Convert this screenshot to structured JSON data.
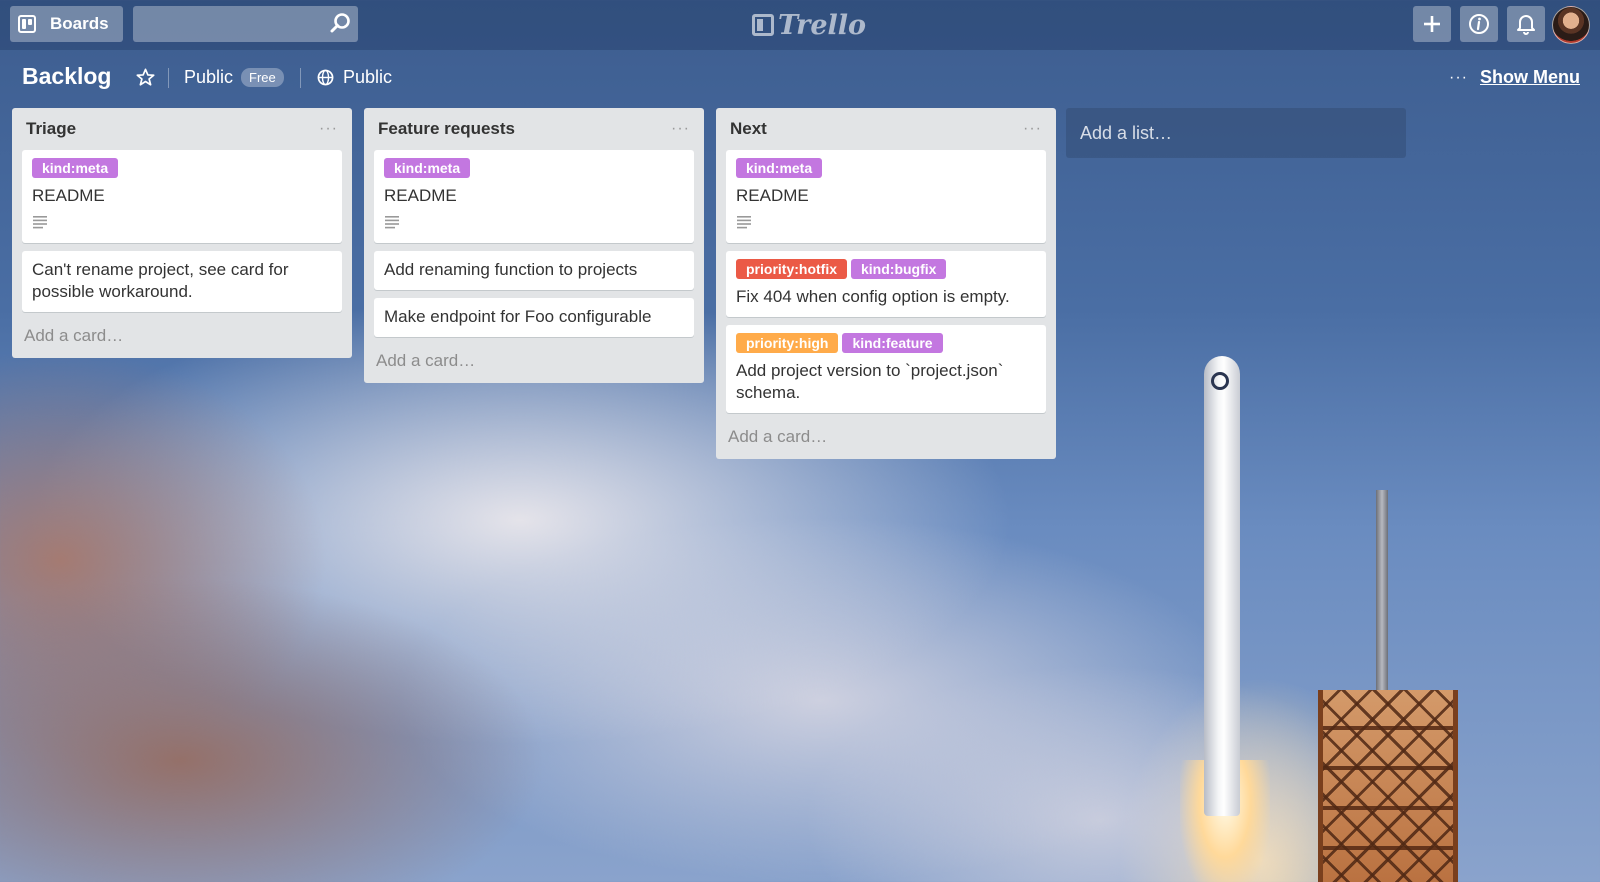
{
  "header": {
    "boards_label": "Boards",
    "search": {
      "value": "",
      "placeholder": ""
    },
    "logo_text": "Trello"
  },
  "board": {
    "title": "Backlog",
    "visibility": "Public",
    "plan_badge": "Free",
    "team_visibility": "Public",
    "menu_dots": "···",
    "show_menu": "Show Menu"
  },
  "colors": {
    "label_purple": "#c377e0",
    "label_red": "#eb5a46",
    "label_orange": "#ffab4a",
    "list_bg": "#e2e4e6"
  },
  "lists": [
    {
      "title": "Triage",
      "menu": "···",
      "add_card": "Add a card…",
      "cards": [
        {
          "labels": [
            {
              "text": "kind:meta"
            }
          ],
          "title": "README"
        },
        {
          "title": "Can't rename project, see card for possible workaround."
        }
      ]
    },
    {
      "title": "Feature requests",
      "menu": "···",
      "add_card": "Add a card…",
      "cards": [
        {
          "labels": [
            {
              "text": "kind:meta"
            }
          ],
          "title": "README"
        },
        {
          "title": "Add renaming function to projects"
        },
        {
          "title": "Make endpoint for Foo configurable"
        }
      ]
    },
    {
      "title": "Next",
      "menu": "···",
      "add_card": "Add a card…",
      "cards": [
        {
          "labels": [
            {
              "text": "kind:meta"
            }
          ],
          "title": "README"
        },
        {
          "labels": [
            {
              "text": "priority:hotfix"
            },
            {
              "text": "kind:bugfix"
            }
          ],
          "title": "Fix 404 when config option is empty."
        },
        {
          "labels": [
            {
              "text": "priority:high"
            },
            {
              "text": "kind:feature"
            }
          ],
          "title": "Add project version to `project.json` schema."
        }
      ]
    }
  ],
  "add_list": "Add a list…"
}
